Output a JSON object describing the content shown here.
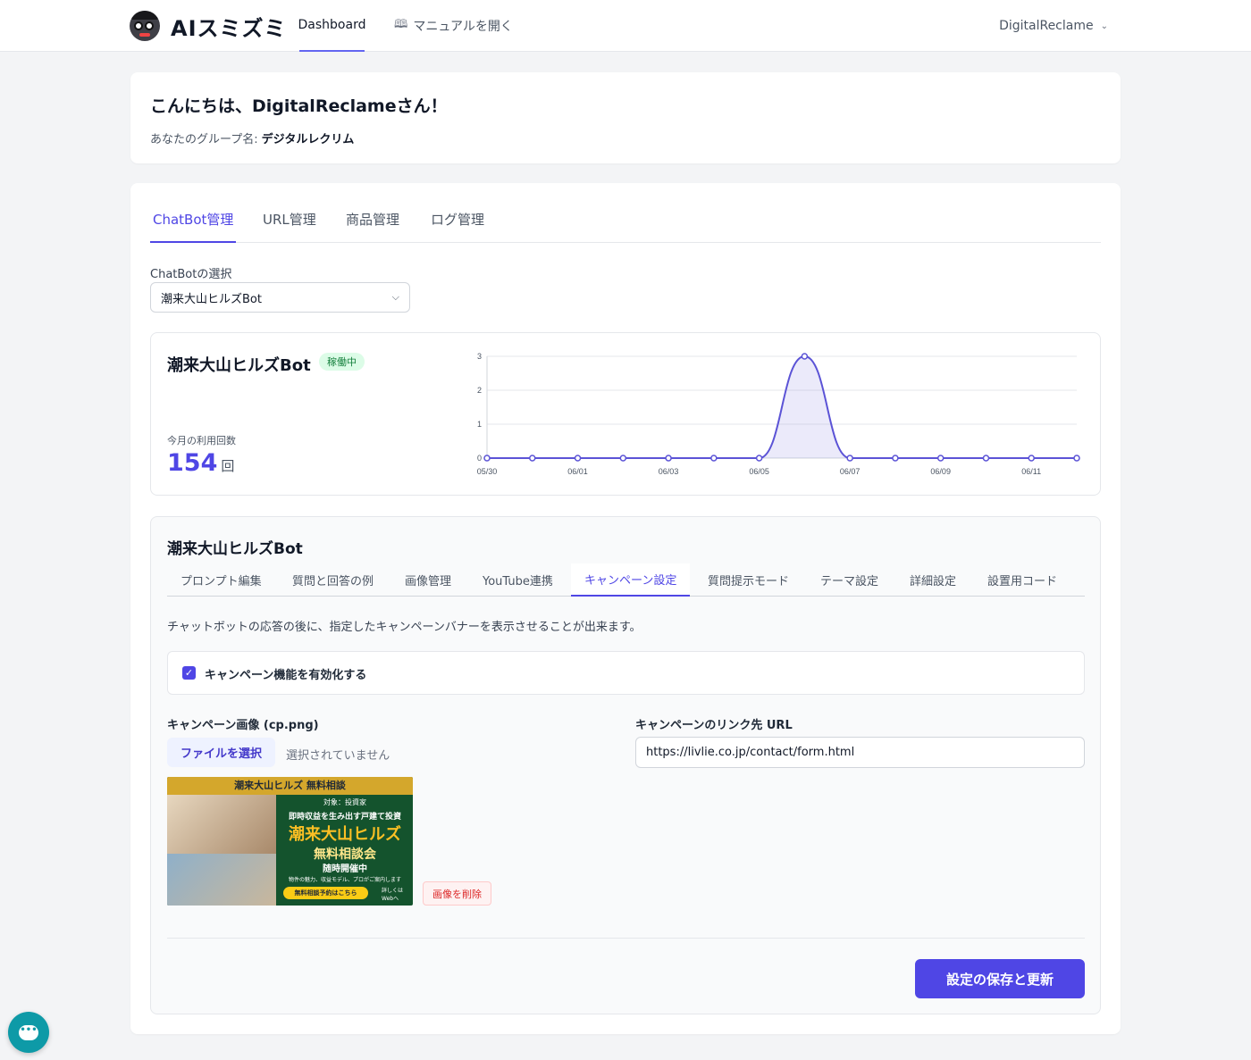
{
  "nav": {
    "logo_text": "AIスミズミ",
    "tabs": [
      {
        "label": "Dashboard"
      },
      {
        "label": "マニュアルを開く",
        "icon": "book-icon"
      }
    ],
    "user_name": "DigitalReclame",
    "accent": "#6366f1"
  },
  "greeting": {
    "title": "こんにちは、DigitalReclameさん！",
    "group_label": "あなたのグループ名:",
    "group_name": "デジタルレクリム"
  },
  "main_tabs": [
    {
      "label": "ChatBot管理",
      "active": true
    },
    {
      "label": "URL管理"
    },
    {
      "label": "商品管理"
    },
    {
      "label": "ログ管理"
    }
  ],
  "chatbot_select": {
    "label": "ChatBotの選択",
    "value": "潮来大山ヒルズBot"
  },
  "stats": {
    "bot_name": "潮来大山ヒルズBot",
    "status": "稼働中",
    "status_color": "#15803d",
    "usage_label": "今月の利用回数",
    "usage_value": "154",
    "usage_unit": "回"
  },
  "chart_data": {
    "type": "area",
    "x": [
      "05/30",
      "05/31",
      "06/01",
      "06/02",
      "06/03",
      "06/04",
      "06/05",
      "06/06",
      "06/07",
      "06/08",
      "06/09",
      "06/10",
      "06/11",
      "06/12"
    ],
    "x_tick_labels": [
      "05/30",
      "06/01",
      "06/03",
      "06/05",
      "06/07",
      "06/09",
      "06/11"
    ],
    "series": [
      {
        "values": [
          0,
          0,
          0,
          0,
          0,
          0,
          0,
          3,
          0,
          0,
          0,
          0,
          0,
          0
        ],
        "color": "#5b53d6"
      }
    ],
    "y_ticks": [
      "0",
      "1",
      "2",
      "3"
    ],
    "ylim": [
      0,
      3
    ],
    "grid": true,
    "title": "",
    "xlabel": "",
    "ylabel": ""
  },
  "settings": {
    "title": "潮来大山ヒルズBot",
    "tabs": [
      {
        "label": "プロンプト編集"
      },
      {
        "label": "質問と回答の例"
      },
      {
        "label": "画像管理"
      },
      {
        "label": "YouTube連携"
      },
      {
        "label": "キャンペーン設定",
        "active": true
      },
      {
        "label": "質問提示モード"
      },
      {
        "label": "テーマ設定"
      },
      {
        "label": "詳細設定"
      },
      {
        "label": "設置用コード"
      }
    ],
    "description": "チャットボットの応答の後に、指定したキャンペーンバナーを表示させることが出来ます。",
    "enable_label": "キャンペーン機能を有効化する",
    "enable_checked": true,
    "image_label": "キャンペーン画像 (cp.png)",
    "file_button": "ファイルを選択",
    "file_status": "選択されていません",
    "link_label": "キャンペーンのリンク先 URL",
    "link_value": "https://livlie.co.jp/contact/form.html",
    "delete_button": "画像を削除",
    "save_button": "設定の保存と更新"
  },
  "banner": {
    "head": "潮来大山ヒルズ 無料相談",
    "line1": "対象：投資家",
    "line2": "即時収益を生み出す戸建て投資",
    "line3": "潮来大山ヒルズ",
    "line4": "無料相談会",
    "line5": "随時開催中",
    "line6": "物件の魅力、収益モデル、プロがご案内します",
    "button": "無料相談予約はこちら",
    "small": "詳しくはWebへ"
  }
}
